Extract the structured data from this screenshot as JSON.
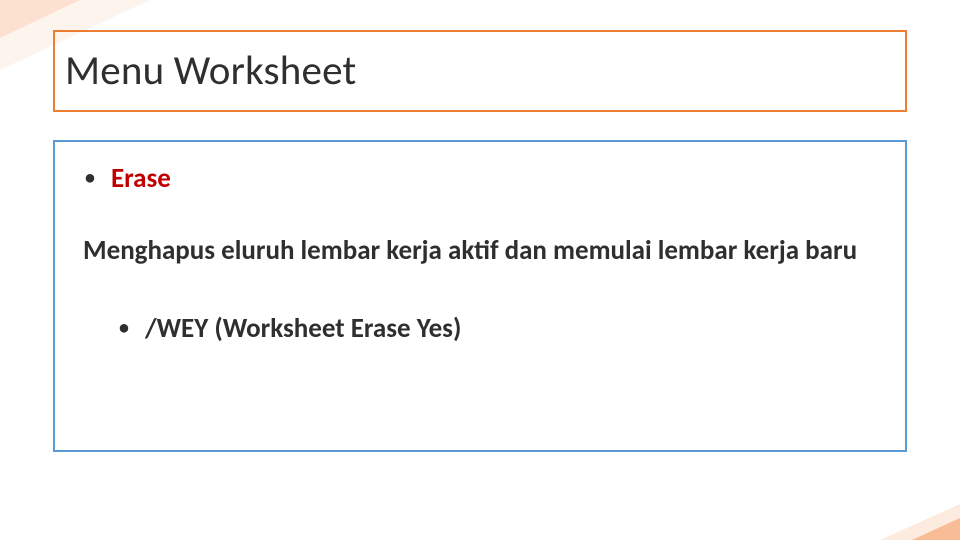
{
  "title": "Menu Worksheet",
  "bullets": {
    "main": {
      "label": "Erase"
    }
  },
  "description": "Menghapus eluruh lembar kerja aktif dan memulai lembar kerja baru",
  "sub_bullet": {
    "label": "/WEY (Worksheet Erase Yes)"
  }
}
